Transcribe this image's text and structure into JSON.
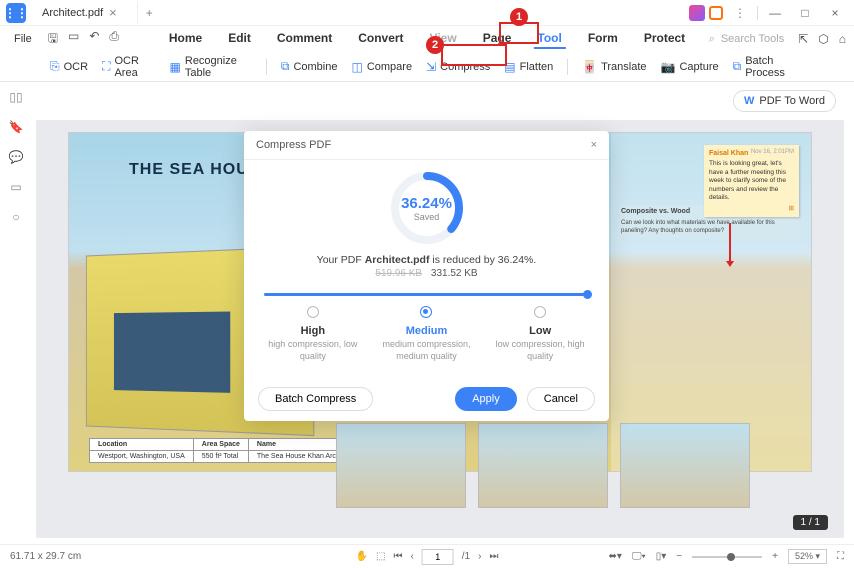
{
  "title_tab": "Architect.pdf",
  "menubar": {
    "file": "File",
    "items": [
      "Home",
      "Edit",
      "Comment",
      "Convert",
      "View",
      "Page",
      "Tool",
      "Form",
      "Protect"
    ],
    "search_placeholder": "Search Tools"
  },
  "toolbar": {
    "ocr": "OCR",
    "ocr_area": "OCR Area",
    "recognize_table": "Recognize Table",
    "combine": "Combine",
    "compare": "Compare",
    "compress": "Compress",
    "flatten": "Flatten",
    "translate": "Translate",
    "capture": "Capture",
    "batch_process": "Batch Process"
  },
  "pdf_to_word": "PDF To Word",
  "document": {
    "title": "THE SEA HOUS",
    "sticky": {
      "author": "Faisal Khan",
      "date": "Nov 16, 2:01PM",
      "body": "This is looking great, let's have a further meeting this week to clarify some of the numbers and review the details."
    },
    "side_q_head": "Composite vs. Wood",
    "side_q_body": "Can we look into what materials we have available for this paneling? Any thoughts on composite?",
    "table": {
      "h1": "Location",
      "h2": "Area Space",
      "h3": "Name",
      "v1": "Westport, Washington, USA",
      "v2": "550 ft² Total",
      "v3": "The Sea House Khan Architects Inc"
    }
  },
  "callouts": {
    "one": "1",
    "two": "2"
  },
  "dialog": {
    "title": "Compress PDF",
    "percent": "36.24%",
    "saved": "Saved",
    "line_pre": "Your PDF ",
    "line_file": "Architect.pdf",
    "line_mid": " is reduced by ",
    "line_pct": "36.24%",
    "old_size": "519.96 KB",
    "new_size": "331.52 KB",
    "high": "High",
    "high_sub": "high compression, low quality",
    "medium": "Medium",
    "medium_sub": "medium compression, medium quality",
    "low": "Low",
    "low_sub": "low compression, high quality",
    "batch": "Batch Compress",
    "apply": "Apply",
    "cancel": "Cancel"
  },
  "statusbar": {
    "dims": "61.71 x 29.7 cm",
    "page_cur": "1",
    "page_total": "/1",
    "zoom": "52%",
    "page_badge": "1 / 1"
  }
}
